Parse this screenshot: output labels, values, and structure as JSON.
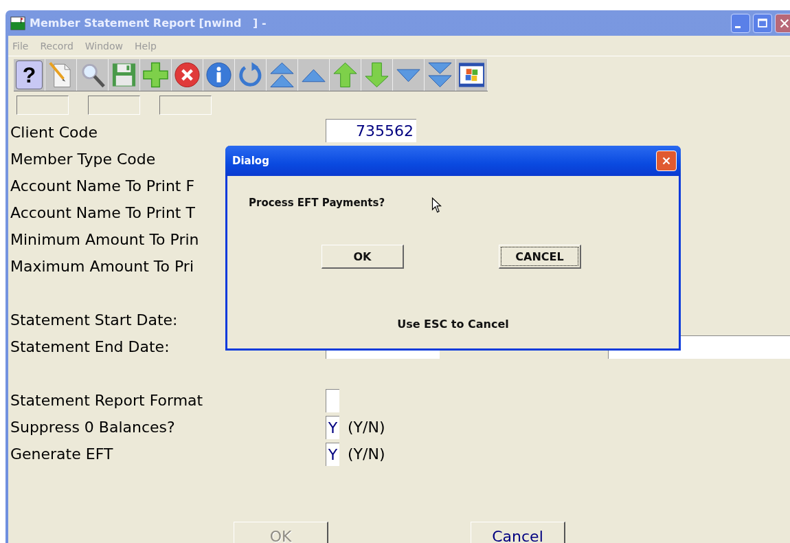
{
  "window": {
    "title": "Member Statement Report [nwind   ] -"
  },
  "menu": [
    {
      "label": "File",
      "disabled": true
    },
    {
      "label": "Record",
      "disabled": true
    },
    {
      "label": "Window",
      "disabled": true
    },
    {
      "label": "Help",
      "disabled": true
    }
  ],
  "toolbar": [
    {
      "kind": "help",
      "glyph": "?"
    },
    {
      "kind": "new"
    },
    {
      "kind": "search"
    },
    {
      "kind": "save"
    },
    {
      "kind": "add"
    },
    {
      "kind": "delete"
    },
    {
      "kind": "info"
    },
    {
      "kind": "refresh"
    },
    {
      "kind": "first"
    },
    {
      "kind": "previous"
    },
    {
      "kind": "up"
    },
    {
      "kind": "down"
    },
    {
      "kind": "next"
    },
    {
      "kind": "last"
    },
    {
      "kind": "window"
    }
  ],
  "form": {
    "groups": [
      [
        {
          "label": "Client Code",
          "kind": "code",
          "value": "735562"
        },
        {
          "label": "Member Type Code",
          "kind": "code"
        },
        {
          "label": "Account Name To Print F",
          "kind": "label"
        },
        {
          "label": "Account Name To Print T",
          "kind": "label"
        },
        {
          "label": "Minimum Amount To Prin",
          "kind": "label"
        },
        {
          "label": "Maximum Amount To Pri",
          "kind": "label"
        }
      ],
      [
        {
          "label": "Statement Start Date:",
          "kind": "label"
        },
        {
          "label": "Statement End Date:",
          "kind": "date"
        }
      ],
      [
        {
          "label": "Statement Report Format",
          "kind": "box"
        },
        {
          "label": "Suppress 0 Balances?",
          "kind": "yn",
          "value": "Y",
          "suffix": "(Y/N)"
        },
        {
          "label": "Generate EFT",
          "kind": "yn",
          "value": "Y",
          "suffix": "(Y/N)"
        }
      ]
    ]
  },
  "buttons": [
    {
      "label": "OK",
      "disabled": true
    },
    {
      "label": "Cancel",
      "disabled": false
    }
  ],
  "dialog": {
    "title": "Dialog",
    "message": "Process EFT Payments?",
    "buttons": [
      {
        "label": "OK",
        "focused": false
      },
      {
        "label": "CANCEL",
        "focused": true
      }
    ],
    "hint": "Use ESC to Cancel"
  }
}
